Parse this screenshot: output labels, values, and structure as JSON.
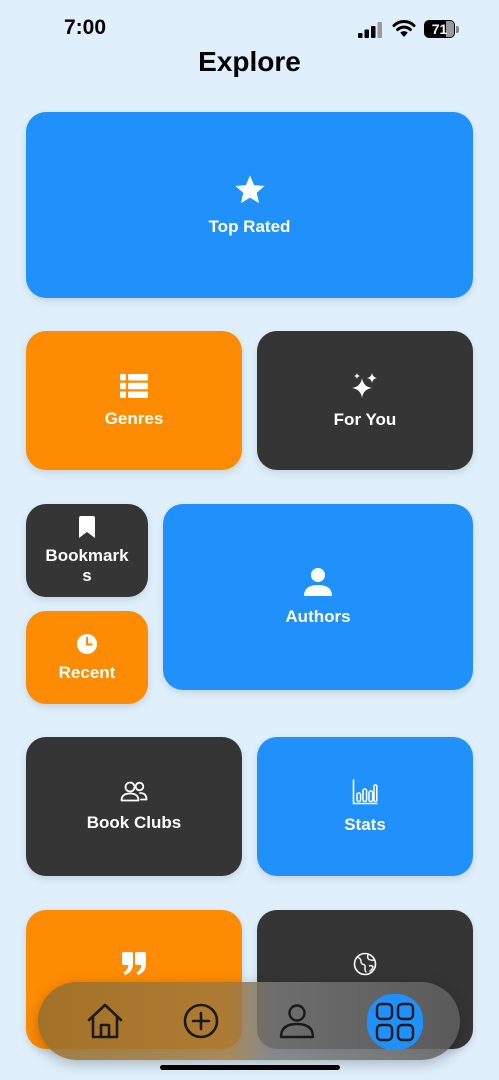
{
  "status": {
    "time": "7:00",
    "battery_level": "71",
    "battery_fraction": 0.71
  },
  "page": {
    "title": "Explore"
  },
  "tiles": {
    "top_rated": {
      "label": "Top Rated",
      "icon": "star-icon",
      "color": "#2090fb"
    },
    "genres": {
      "label": "Genres",
      "icon": "list-icon",
      "color": "#fd8c02"
    },
    "for_you": {
      "label": "For You",
      "icon": "sparkles-icon",
      "color": "#353535"
    },
    "bookmarks": {
      "label": "Bookmarks",
      "icon": "bookmark-icon",
      "color": "#353535"
    },
    "recent": {
      "label": "Recent",
      "icon": "clock-icon",
      "color": "#fd8c02"
    },
    "authors": {
      "label": "Authors",
      "icon": "person-icon",
      "color": "#2090fb"
    },
    "book_clubs": {
      "label": "Book Clubs",
      "icon": "group-icon",
      "color": "#353535"
    },
    "stats": {
      "label": "Stats",
      "icon": "bar-chart-icon",
      "color": "#2090fb"
    },
    "quotes": {
      "label": "",
      "icon": "quote-icon",
      "color": "#fd8c02"
    },
    "world": {
      "label": "",
      "icon": "globe-icon",
      "color": "#353535"
    }
  },
  "tab_bar": {
    "items": [
      {
        "icon": "home-icon",
        "active": false
      },
      {
        "icon": "add-circle-icon",
        "active": false
      },
      {
        "icon": "profile-icon",
        "active": false
      },
      {
        "icon": "grid-icon",
        "active": true
      }
    ],
    "active_color": "#2090fb"
  }
}
